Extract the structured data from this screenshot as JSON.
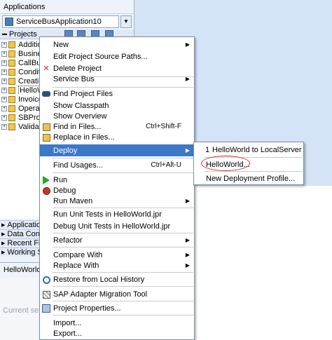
{
  "applications_panel": {
    "title": "Applications",
    "app_name": "ServiceBusApplication10",
    "projects_label": "Projects",
    "projects": [
      {
        "label": "Additio"
      },
      {
        "label": "Busines"
      },
      {
        "label": "CallBusi"
      },
      {
        "label": "Conditio"
      },
      {
        "label": "Creatin"
      },
      {
        "label": "HelloWor"
      },
      {
        "label": "Invoice"
      },
      {
        "label": "Operati"
      },
      {
        "label": "SBProje"
      },
      {
        "label": "Validate"
      }
    ],
    "accordions": [
      {
        "label": "Application R"
      },
      {
        "label": "Data Contro"
      },
      {
        "label": "Recent Files"
      },
      {
        "label": "Working Set"
      }
    ]
  },
  "structure_panel": {
    "title": "HelloWorld.jpr",
    "empty_text": "Current selecti"
  },
  "context_menu": {
    "new": "New",
    "edit_source_paths": "Edit Project Source Paths...",
    "delete_project": "Delete Project",
    "service_bus": "Service Bus",
    "find_project_files": "Find Project Files",
    "show_classpath": "Show Classpath",
    "show_overview": "Show Overview",
    "find_in_files": "Find in Files...",
    "find_in_files_accel": "Ctrl+Shift-F",
    "replace_in_files": "Replace in Files...",
    "deploy": "Deploy",
    "find_usages": "Find Usages...",
    "find_usages_accel": "Ctrl+Alt-U",
    "run": "Run",
    "debug": "Debug",
    "run_maven": "Run Maven",
    "run_unit_tests": "Run Unit Tests in HelloWorld.jpr",
    "debug_unit_tests": "Debug Unit Tests in HelloWorld.jpr",
    "refactor": "Refactor",
    "compare_with": "Compare With",
    "replace_with": "Replace With",
    "restore_local_history": "Restore from Local History",
    "sap_adapter_tool": "SAP Adapter Migration Tool",
    "project_properties": "Project Properties...",
    "import": "Import...",
    "export": "Export..."
  },
  "deploy_submenu": {
    "item1_number": "1",
    "item1_label": "HelloWorld to LocalServer",
    "item2_label": "HelloWorld...",
    "item3_label": "New Deployment Profile..."
  },
  "colors": {
    "highlight": "#3c78c8",
    "annotation": "#e0241f",
    "background": "#d4e3f5"
  }
}
